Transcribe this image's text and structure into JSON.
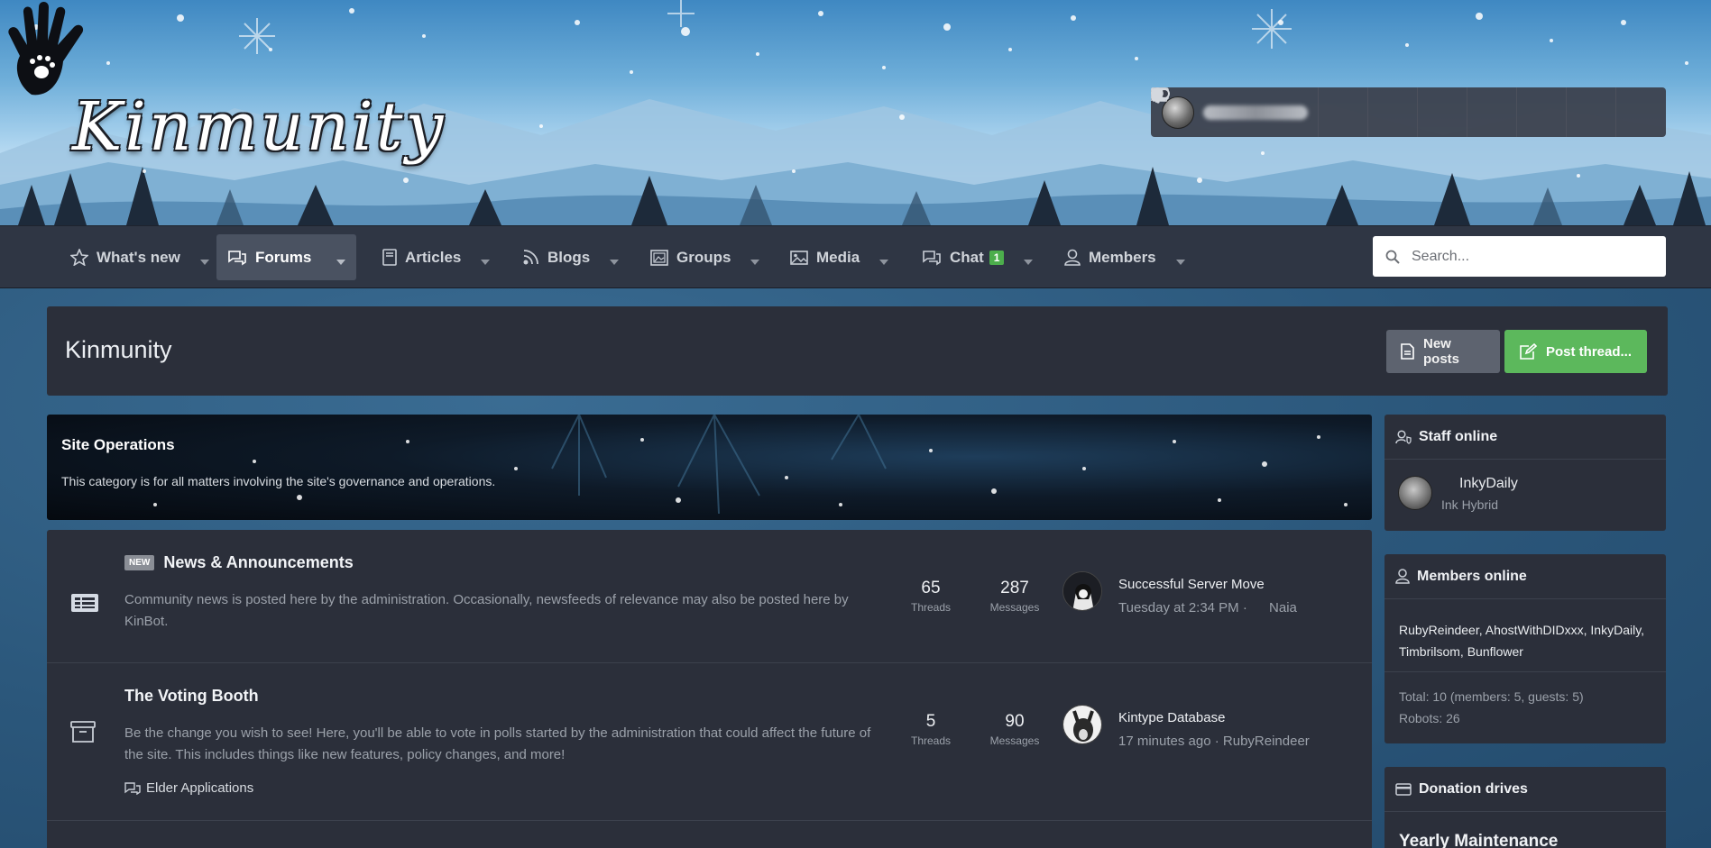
{
  "site": {
    "logo_text": "Kinmunity"
  },
  "userbar": {
    "icons": [
      "envelope-icon",
      "bell-icon",
      "credit-card-icon",
      "basket-icon",
      "toggle-icon",
      "lightbulb-icon",
      "search-icon"
    ]
  },
  "nav": {
    "tabs": [
      {
        "label": "What's new",
        "icon": "star-icon"
      },
      {
        "label": "Forums",
        "icon": "comments-icon",
        "active": true
      },
      {
        "label": "Articles",
        "icon": "book-icon"
      },
      {
        "label": "Blogs",
        "icon": "rss-icon"
      },
      {
        "label": "Groups",
        "icon": "image-gallery-icon"
      },
      {
        "label": "Media",
        "icon": "image-icon"
      },
      {
        "label": "Chat",
        "icon": "chat-icon",
        "badge": "1"
      },
      {
        "label": "Members",
        "icon": "user-icon"
      }
    ],
    "search_placeholder": "Search..."
  },
  "page": {
    "title": "Kinmunity",
    "new_posts_label": "New posts",
    "post_thread_label": "Post thread..."
  },
  "category": {
    "title": "Site Operations",
    "description": "This category is for all matters involving the site's governance and operations."
  },
  "forums": [
    {
      "badge": "NEW",
      "title": "News & Announcements",
      "description": "Community news is posted here by the administration. Occasionally, newsfeeds of relevance may also be posted here by KinBot.",
      "threads": "65",
      "threads_label": "Threads",
      "messages": "287",
      "messages_label": "Messages",
      "last_post_title": "Successful Server Move",
      "last_post_time": "Tuesday at 2:34 PM",
      "last_post_separator": "·",
      "last_post_user": "Naia"
    },
    {
      "title": "The Voting Booth",
      "description": "Be the change you wish to see! Here, you'll be able to vote in polls started by the administration that could affect the future of the site. This includes things like new features, policy changes, and more!",
      "subforum": "Elder Applications",
      "threads": "5",
      "threads_label": "Threads",
      "messages": "90",
      "messages_label": "Messages",
      "last_post_title": "Kintype Database",
      "last_post_meta": "17 minutes ago · RubyReindeer"
    }
  ],
  "sidebar": {
    "staff": {
      "title": "Staff online",
      "name": "InkyDaily",
      "role": "Ink Hybrid"
    },
    "members": {
      "title": "Members online",
      "list": "RubyReindeer, AhostWithDIDxxx, InkyDaily, Timbrilsom, Bunflower",
      "total": "Total: 10 (members: 5, guests: 5)",
      "robots": "Robots: 26"
    },
    "donations": {
      "title": "Donation drives",
      "drive": "Yearly Maintenance"
    }
  },
  "colors": {
    "accent_green": "#5cb85c",
    "panel": "#2b2f3a",
    "nav": "#2f3644",
    "badge_green": "#4cae4c"
  }
}
